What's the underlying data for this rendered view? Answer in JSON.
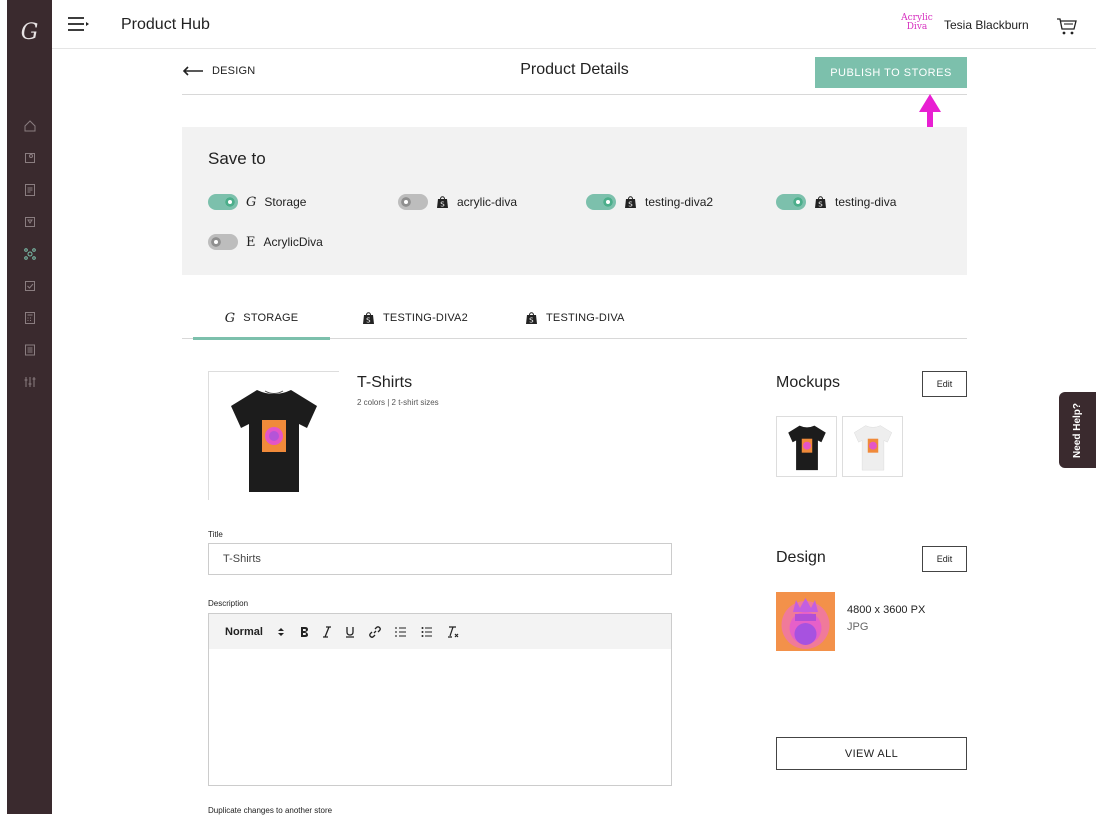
{
  "app": {
    "logo": "G",
    "title": "Product Hub",
    "brand_badge": [
      "Acrylic",
      "Diva"
    ],
    "user_name": "Tesia Blackburn"
  },
  "sidebar": {
    "items": [
      {
        "icon": "home-icon"
      },
      {
        "icon": "products-icon"
      },
      {
        "icon": "orders-icon"
      },
      {
        "icon": "mockup-icon"
      },
      {
        "icon": "integrations-icon"
      },
      {
        "icon": "checklist-icon"
      },
      {
        "icon": "calculator-icon"
      },
      {
        "icon": "documents-icon"
      },
      {
        "icon": "settings-sliders-icon"
      }
    ]
  },
  "subheader": {
    "back_label": "DESIGN",
    "page_title": "Product Details",
    "publish_label": "PUBLISH TO STORES"
  },
  "save_to": {
    "title": "Save to",
    "stores": [
      {
        "name": "Storage",
        "enabled": true,
        "platform": "G"
      },
      {
        "name": "acrylic-diva",
        "enabled": false,
        "platform": "shopify"
      },
      {
        "name": "testing-diva2",
        "enabled": true,
        "platform": "shopify"
      },
      {
        "name": "testing-diva",
        "enabled": true,
        "platform": "shopify"
      },
      {
        "name": "AcrylicDiva",
        "enabled": false,
        "platform": "E"
      }
    ]
  },
  "tabs": [
    {
      "label": "STORAGE",
      "active": true
    },
    {
      "label": "TESTING-DIVA2",
      "active": false
    },
    {
      "label": "TESTING-DIVA",
      "active": false
    }
  ],
  "product": {
    "name": "T-Shirts",
    "meta": "2 colors | 2 t-shirt sizes"
  },
  "form": {
    "title_label": "Title",
    "title_value": "T-Shirts",
    "description_label": "Description",
    "editor_format": "Normal",
    "duplicate_label": "Duplicate changes to another store"
  },
  "mockups": {
    "title": "Mockups",
    "edit_label": "Edit",
    "items": [
      {
        "color": "black"
      },
      {
        "color": "white"
      }
    ]
  },
  "design": {
    "title": "Design",
    "edit_label": "Edit",
    "dimensions": "4800 x 3600 PX",
    "file_type": "JPG",
    "view_all_label": "VIEW ALL"
  },
  "help": {
    "label": "Need Help?"
  },
  "colors": {
    "accent": "#7cc0ac",
    "rail": "#3a2a2e",
    "annotation_arrow": "#e81fd2"
  }
}
